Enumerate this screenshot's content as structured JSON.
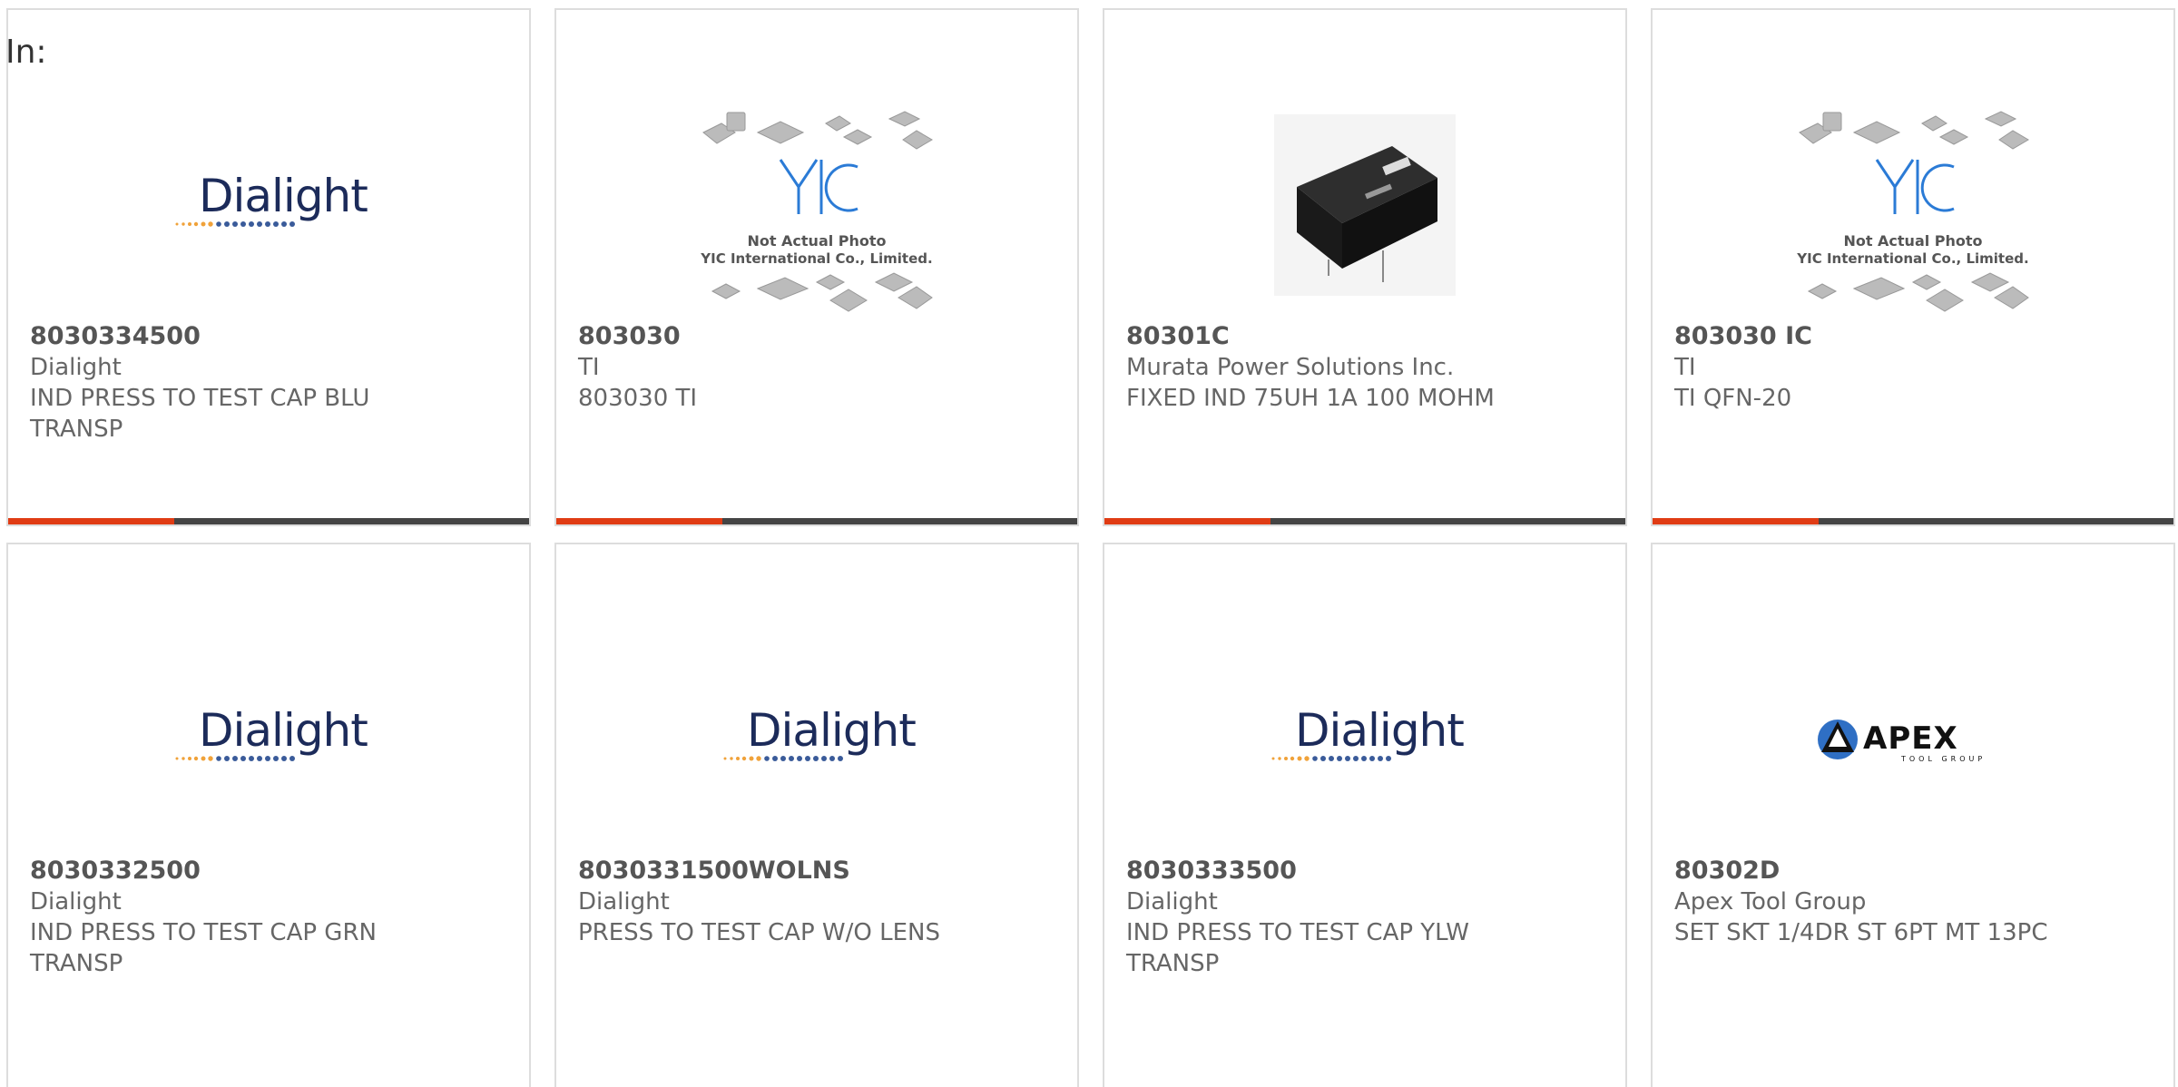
{
  "header": {
    "in_label": "In:"
  },
  "colors": {
    "accent": "#e03c14",
    "bar": "#444444",
    "card_border": "#dddddd",
    "text": "#666666"
  },
  "products": [
    {
      "part_number": "8030334500",
      "manufacturer": "Dialight",
      "description": "IND PRESS TO TEST CAP BLU TRANSP",
      "image": "dialight-logo"
    },
    {
      "part_number": "803030",
      "manufacturer": "TI",
      "description": "803030 TI",
      "image": "yic-not-actual-photo",
      "image_text_1": "Not Actual Photo",
      "image_text_2": "YIC International Co., Limited."
    },
    {
      "part_number": "80301C",
      "manufacturer": "Murata Power Solutions Inc.",
      "description": "FIXED IND 75UH 1A 100 MOHM",
      "image": "inductor-photo"
    },
    {
      "part_number": "803030 IC",
      "manufacturer": "TI",
      "description": "TI QFN-20",
      "image": "yic-not-actual-photo",
      "image_text_1": "Not Actual Photo",
      "image_text_2": "YIC International Co., Limited."
    },
    {
      "part_number": "8030332500",
      "manufacturer": "Dialight",
      "description": "IND PRESS TO TEST CAP GRN TRANSP",
      "image": "dialight-logo"
    },
    {
      "part_number": "8030331500WOLNS",
      "manufacturer": "Dialight",
      "description": "PRESS TO TEST CAP W/O LENS",
      "image": "dialight-logo"
    },
    {
      "part_number": "8030333500",
      "manufacturer": "Dialight",
      "description": "IND PRESS TO TEST CAP YLW TRANSP",
      "image": "dialight-logo"
    },
    {
      "part_number": "80302D",
      "manufacturer": "Apex Tool Group",
      "description": "SET SKT 1/4DR ST 6PT MT 13PC",
      "image": "apex-logo"
    }
  ],
  "logo_text": {
    "dialight": "Dialight",
    "apex": "APEX",
    "apex_sub": "TOOL GROUP",
    "yic": "YIC"
  }
}
